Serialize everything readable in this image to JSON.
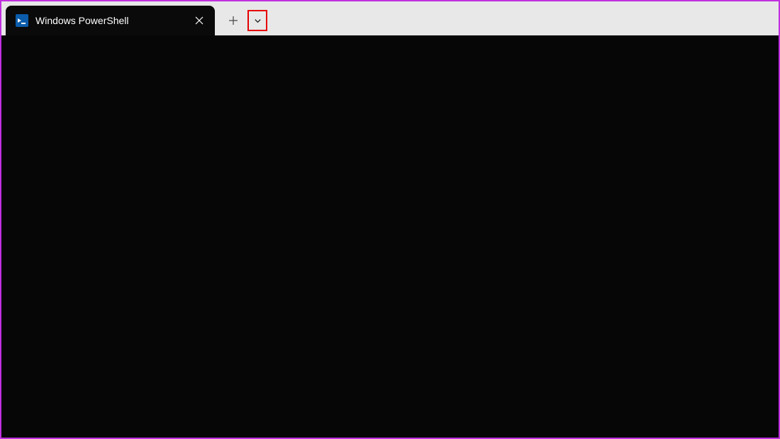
{
  "tab": {
    "title": "Windows PowerShell",
    "icon_name": "powershell-icon"
  },
  "actions": {
    "close_label": "Close",
    "new_tab_label": "New Tab",
    "dropdown_label": "New Tab Dropdown"
  },
  "terminal": {
    "content": ""
  }
}
